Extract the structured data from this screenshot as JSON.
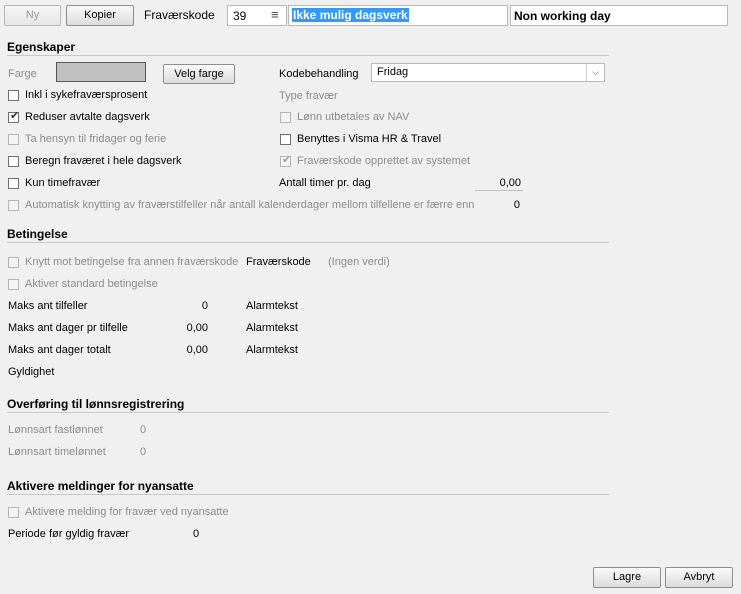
{
  "toolbar": {
    "new_label": "Ny",
    "copy_label": "Kopier",
    "code_label": "Fraværskode",
    "code_value": "39",
    "name_value": "Ikke mulig dagsverk",
    "name_en_value": "Non working day"
  },
  "egenskaper": {
    "title": "Egenskaper",
    "color_label": "Farge",
    "color_value": "#c0c0c0",
    "choose_color_label": "Velg farge",
    "code_handling_label": "Kodebehandling",
    "code_handling_value": "Fridag",
    "absence_type_label": "Type fravær",
    "checkboxes_left": [
      {
        "label": "Inkl i sykefraværsprosent",
        "checked": false,
        "enabled": true
      },
      {
        "label": "Reduser avtalte dagsverk",
        "checked": true,
        "enabled": true
      },
      {
        "label": "Ta hensyn til fridager og ferie",
        "checked": false,
        "enabled": false
      },
      {
        "label": "Beregn fraværet i hele dagsverk",
        "checked": false,
        "enabled": true
      },
      {
        "label": "Kun timefravær",
        "checked": false,
        "enabled": true
      }
    ],
    "checkboxes_right": [
      {
        "label": "Lønn utbetales av NAV",
        "checked": false,
        "enabled": false
      },
      {
        "label": "Benyttes i Visma HR & Travel",
        "checked": false,
        "enabled": true
      },
      {
        "label": "Fraværskode opprettet av systemet",
        "checked": true,
        "enabled": false
      }
    ],
    "hours_per_day_label": "Antall timer pr. dag",
    "hours_per_day_value": "0,00",
    "auto_link_label": "Automatisk knytting av fraværstilfeller når antall kalenderdager mellom tilfellene er færre enn",
    "auto_link_value": "0"
  },
  "betingelse": {
    "title": "Betingelse",
    "link_label": "Knytt mot betingelse fra annen fraværskode",
    "code_label": "Fraværskode",
    "code_value": "(Ingen verdi)",
    "standard_label": "Aktiver standard betingelse",
    "rows": [
      {
        "label": "Maks ant tilfeller",
        "value": "0",
        "alarm": "Alarmtekst"
      },
      {
        "label": "Maks ant dager pr tilfelle",
        "value": "0,00",
        "alarm": "Alarmtekst"
      },
      {
        "label": "Maks ant dager totalt",
        "value": "0,00",
        "alarm": "Alarmtekst"
      }
    ],
    "validity_label": "Gyldighet"
  },
  "overforing": {
    "title": "Overføring til lønnsregistrering",
    "fixed_label": "Lønnsart fastlønnet",
    "fixed_value": "0",
    "hourly_label": "Lønnsart timelønnet",
    "hourly_value": "0"
  },
  "meldinger": {
    "title": "Aktivere meldinger for nyansatte",
    "activate_label": "Aktivere melding for fravær ved nyansatte",
    "period_label": "Periode før gyldig fravær",
    "period_value": "0"
  },
  "footer": {
    "save_label": "Lagre",
    "cancel_label": "Avbryt"
  }
}
